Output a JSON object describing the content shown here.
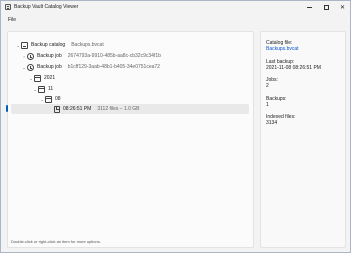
{
  "window": {
    "title": "Backup Vault Catalog Viewer",
    "minimize_icon": "minimize-icon",
    "maximize_icon": "maximize-icon",
    "close_icon": "close-icon",
    "close_glyph": "✕"
  },
  "menu": {
    "file_label": "File"
  },
  "tree": {
    "root": {
      "label": "Backup catalog",
      "sub": "Backups.bvcat",
      "icon": "database-icon"
    },
    "jobs": [
      {
        "label": "Backup job",
        "sub": "2674793a-9910-485b-aa8c-cb32c9c34f1b",
        "icon": "history-icon"
      },
      {
        "label": "Backup job",
        "sub": "b1cff129-3aab-48b1-b405-34e0751cea72",
        "icon": "history-icon"
      }
    ],
    "year": {
      "label": "2021",
      "icon": "calendar-icon"
    },
    "month": {
      "label": "11",
      "icon": "calendar-icon"
    },
    "day": {
      "label": "08",
      "icon": "calendar-icon"
    },
    "backup": {
      "label": "08:26:51 PM",
      "sub": "3112 files – 1.0 GB",
      "icon": "file-icon"
    },
    "chevrons": {
      "expanded": "⌄",
      "collapsed": "›"
    }
  },
  "hint": "Double-click or right-click an item for more options.",
  "details": {
    "catalog_file_label": "Catalog file:",
    "catalog_file_value": "Backups.bvcat",
    "last_backup_label": "Last backup:",
    "last_backup_value": "2021-11-08 08:26:51 PM",
    "jobs_label": "Jobs:",
    "jobs_value": "2",
    "backups_label": "Backups:",
    "backups_value": "1",
    "indexed_files_label": "Indexed files:",
    "indexed_files_value": "3134"
  },
  "colors": {
    "accent": "#005fb8",
    "link": "#0b57d0",
    "selection": "#e9e9e9"
  }
}
